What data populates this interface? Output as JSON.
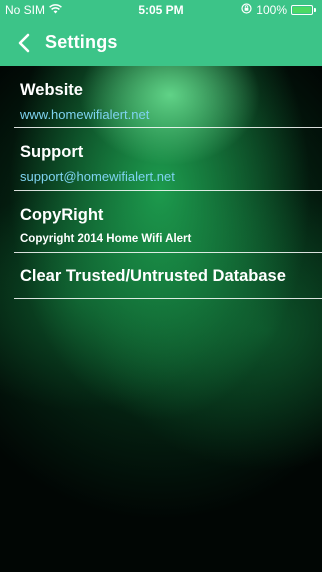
{
  "status_bar": {
    "carrier": "No SIM",
    "time": "5:05 PM",
    "battery": "100%",
    "wifi_icon": "wifi-icon",
    "lock_icon": "rotation-lock-icon",
    "battery_icon": "battery-icon",
    "battery_color": "#4cd964"
  },
  "nav": {
    "title": "Settings",
    "back_icon": "chevron-left-icon",
    "background": "#3cc488"
  },
  "rows": [
    {
      "title": "Website",
      "subtitle": "www.homewifialert.net"
    },
    {
      "title": "Support",
      "subtitle": "support@homewifialert.net"
    },
    {
      "title": "CopyRight",
      "subtitle": "Copyright 2014 Home Wifi Alert"
    },
    {
      "title": "Clear Trusted/Untrusted Database"
    }
  ],
  "colors": {
    "link": "#7fd3f0",
    "text": "#ffffff"
  }
}
